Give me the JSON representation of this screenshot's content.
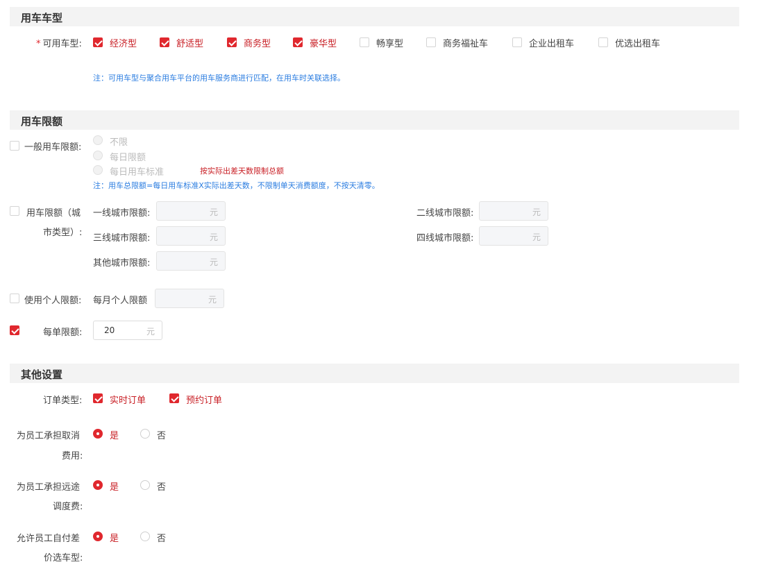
{
  "sections": {
    "vehicle": "用车车型",
    "limit": "用车限额",
    "other": "其他设置"
  },
  "vehicle": {
    "required_mark": "*",
    "label": "可用车型:",
    "types": [
      {
        "label": "经济型",
        "checked": true
      },
      {
        "label": "舒适型",
        "checked": true
      },
      {
        "label": "商务型",
        "checked": true
      },
      {
        "label": "豪华型",
        "checked": true
      },
      {
        "label": "畅享型",
        "checked": false
      },
      {
        "label": "商务福祉车",
        "checked": false
      },
      {
        "label": "企业出租车",
        "checked": false
      },
      {
        "label": "优选出租车",
        "checked": false
      }
    ],
    "note": "注：可用车型与聚合用车平台的用车服务商进行匹配，在用车时关联选择。"
  },
  "limit": {
    "general": {
      "label": "一般用车限额:",
      "options": [
        "不限",
        "每日限额",
        "每日用车标准"
      ],
      "red_note": "按实际出差天数限制总额",
      "note": "注：用车总限额=每日用车标准X实际出差天数，不限制单天消费额度，不按天清零。"
    },
    "city": {
      "label_line1": "用车限额（城",
      "label_line2": "市类型）:",
      "tier1": "一线城市限额:",
      "tier2": "二线城市限额:",
      "tier3": "三线城市限额:",
      "tier4": "四线城市限额:",
      "other": "其他城市限额:",
      "unit": "元"
    },
    "personal": {
      "label": "使用个人限额:",
      "monthly": "每月个人限额",
      "unit": "元"
    },
    "per_order": {
      "label": "每单限额:",
      "value": "20",
      "unit": "元",
      "checked": true
    }
  },
  "other": {
    "order_type": {
      "label": "订单类型:",
      "options": [
        {
          "label": "实时订单",
          "checked": true
        },
        {
          "label": "预约订单",
          "checked": true
        }
      ]
    },
    "cancel_fee": {
      "label_line1": "为员工承担取消",
      "label_line2": "费用:",
      "yes": "是",
      "no": "否"
    },
    "dispatch_fee": {
      "label_line1": "为员工承担远途",
      "label_line2": "调度费:",
      "yes": "是",
      "no": "否"
    },
    "price_diff": {
      "label_line1": "允许员工自付差",
      "label_line2": "价选车型:",
      "yes": "是",
      "no": "否"
    }
  },
  "colors": {
    "accent": "#e0282e",
    "note_blue": "#2b7de0"
  }
}
